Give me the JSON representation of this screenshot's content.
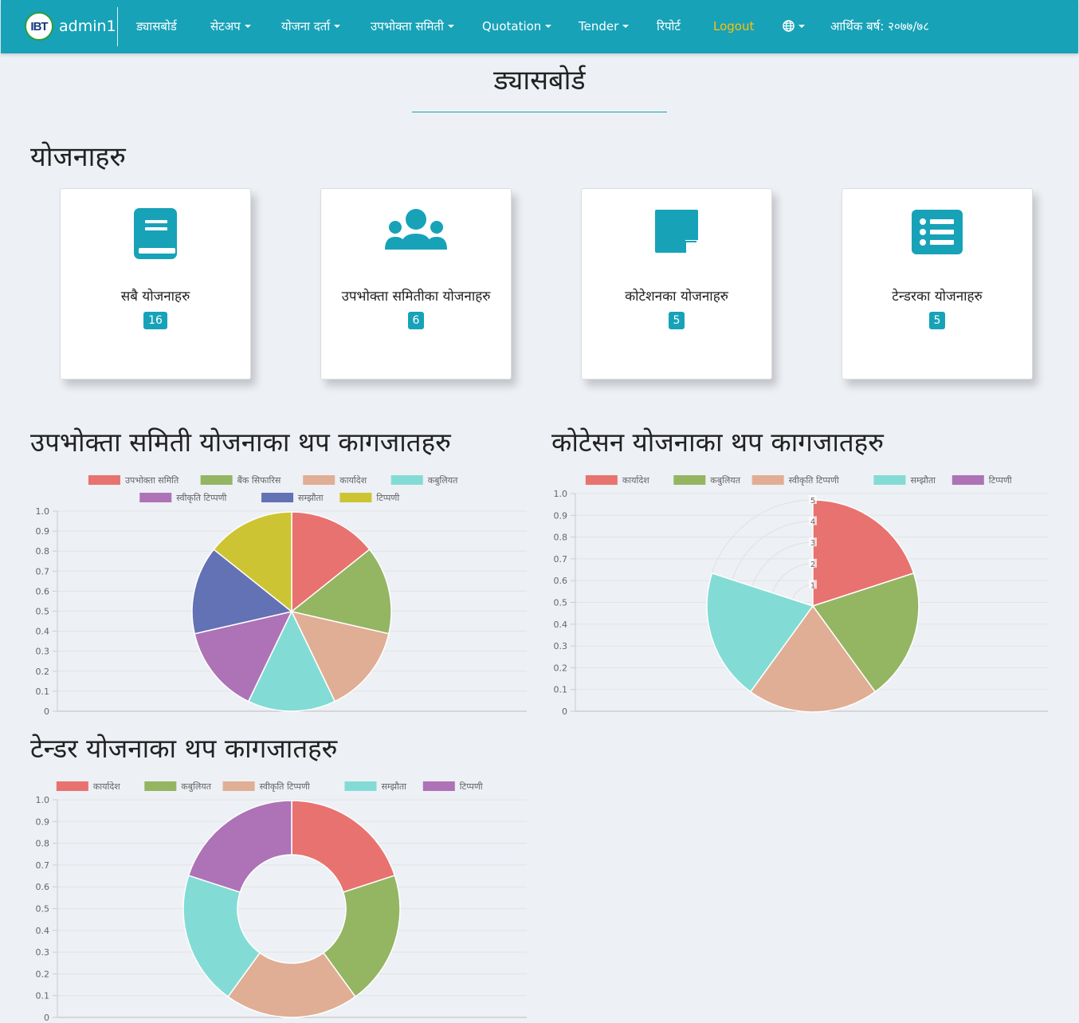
{
  "navbar": {
    "brand_logo": "IBT",
    "brand_name": "admin1",
    "items": [
      {
        "label": "ड्यासबोर्ड",
        "dropdown": false
      },
      {
        "label": "सेटअप",
        "dropdown": true
      },
      {
        "label": "योजना दर्ता",
        "dropdown": true
      },
      {
        "label": "उपभोक्ता समिती",
        "dropdown": true
      },
      {
        "label": "Quotation",
        "dropdown": true
      },
      {
        "label": "Tender",
        "dropdown": true
      },
      {
        "label": "रिपोर्ट",
        "dropdown": false
      },
      {
        "label": "Logout",
        "dropdown": false
      }
    ],
    "language_icon": "globe-icon",
    "fiscal_year": "आर्थिक बर्ष: २०७७/७८",
    "colors": {
      "background": "#17a2b8",
      "logout": "#ffc107"
    }
  },
  "page": {
    "title": "ड्यासबोर्ड",
    "section_title": "योजनाहरु"
  },
  "cards": [
    {
      "icon": "book-icon",
      "label": "सबै योजनाहरु",
      "count": "16"
    },
    {
      "icon": "users-icon",
      "label": "उपभोक्ता समितीका योजनाहरु",
      "count": "6"
    },
    {
      "icon": "sticky-note-icon",
      "label": "कोटेशनका योजनाहरु",
      "count": "5"
    },
    {
      "icon": "list-icon",
      "label": "टेन्डरका योजनाहरु",
      "count": "5"
    }
  ],
  "charts": {
    "consumer": {
      "heading": "उपभोक्ता समिती योजनाका थप कागजातहरु"
    },
    "quotation": {
      "heading": "कोटेसन योजनाका थप कागजातहरु"
    },
    "tender": {
      "heading": "टेन्डर योजनाका थप कागजातहरु"
    }
  },
  "chart_data": [
    {
      "type": "pie",
      "title": "उपभोक्ता समिती योजनाका थप कागजातहरु",
      "categories": [
        "उपभोक्ता समिति",
        "बैंक सिफारिस",
        "कार्यादेश",
        "कबुलियत",
        "स्वीकृति टिप्पणी",
        "सम्झौता",
        "टिप्पणी"
      ],
      "values": [
        1,
        1,
        1,
        1,
        1,
        1,
        1
      ],
      "colors": [
        "#e8726f",
        "#94b562",
        "#e0ae94",
        "#82dcd5",
        "#ad73b6",
        "#6372b4",
        "#cdc433"
      ],
      "y_axis_ticks": [
        "0",
        "0.1",
        "0.2",
        "0.3",
        "0.4",
        "0.5",
        "0.6",
        "0.7",
        "0.8",
        "0.9",
        "1.0"
      ],
      "ylim": [
        0,
        1.0
      ],
      "grid": true,
      "legend_position": "top"
    },
    {
      "type": "polarArea",
      "title": "कोटेसन योजनाका थप कागजातहरु",
      "categories": [
        "कार्यादेश",
        "कबुलियत",
        "स्वीकृति टिप्पणी",
        "सम्झौता",
        "टिप्पणी"
      ],
      "values": [
        5,
        5,
        5,
        5,
        0
      ],
      "colors": [
        "#e8726f",
        "#94b562",
        "#e0ae94",
        "#82dcd5",
        "#ad73b6"
      ],
      "radial_ticks": [
        "1",
        "2",
        "3",
        "4",
        "5"
      ],
      "radial_max": 5,
      "y_axis_ticks": [
        "0",
        "0.1",
        "0.2",
        "0.3",
        "0.4",
        "0.5",
        "0.6",
        "0.7",
        "0.8",
        "0.9",
        "1.0"
      ],
      "ylim": [
        0,
        1.0
      ],
      "grid": true,
      "legend_position": "top"
    },
    {
      "type": "doughnut",
      "title": "टेन्डर योजनाका थप कागजातहरु",
      "categories": [
        "कार्यादेश",
        "कबुलियत",
        "स्वीकृति टिप्पणी",
        "सम्झौता",
        "टिप्पणी"
      ],
      "values": [
        1,
        1,
        1,
        1,
        1
      ],
      "colors": [
        "#e8726f",
        "#94b562",
        "#e0ae94",
        "#82dcd5",
        "#ad73b6"
      ],
      "y_axis_ticks": [
        "0",
        "0.1",
        "0.2",
        "0.3",
        "0.4",
        "0.5",
        "0.6",
        "0.7",
        "0.8",
        "0.9",
        "1.0"
      ],
      "ylim": [
        0,
        1.0
      ],
      "grid": true,
      "legend_position": "top"
    }
  ]
}
